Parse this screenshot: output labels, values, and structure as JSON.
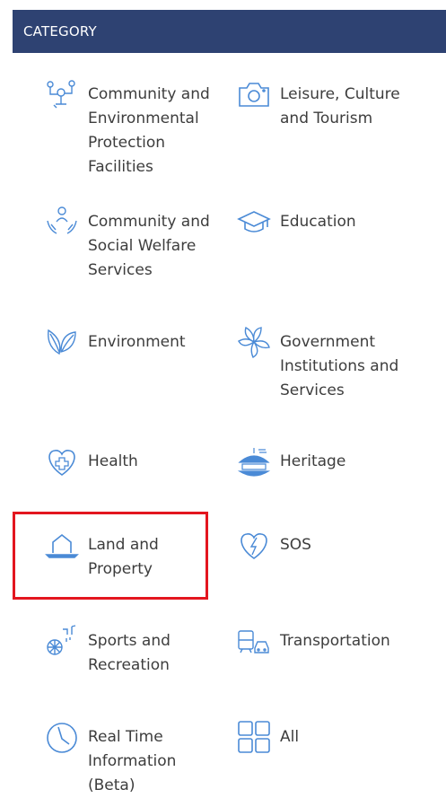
{
  "header": {
    "title": "CATEGORY"
  },
  "categories": [
    {
      "label": "Community and Environmental Protection Facilities",
      "icon": "community-facilities-icon"
    },
    {
      "label": "Leisure, Culture and Tourism",
      "icon": "camera-icon"
    },
    {
      "label": "Community and Social Welfare Services",
      "icon": "hands-person-icon"
    },
    {
      "label": "Education",
      "icon": "graduation-cap-icon"
    },
    {
      "label": "Environment",
      "icon": "leaves-icon"
    },
    {
      "label": "Government Institutions and Services",
      "icon": "bauhinia-icon"
    },
    {
      "label": "Health",
      "icon": "heart-plus-icon"
    },
    {
      "label": "Heritage",
      "icon": "pavilion-icon"
    },
    {
      "label": "Land and Property",
      "icon": "land-icon"
    },
    {
      "label": "SOS",
      "icon": "broken-heart-bolt-icon"
    },
    {
      "label": "Sports and Recreation",
      "icon": "ball-music-icon"
    },
    {
      "label": "Transportation",
      "icon": "train-car-icon"
    },
    {
      "label": "Real Time Information (Beta)",
      "icon": "clock-icon"
    },
    {
      "label": "All",
      "icon": "grid-icon"
    }
  ],
  "colors": {
    "header_bg": "#2e4272",
    "icon": "#4a8ad6",
    "highlight": "#e3161f"
  }
}
